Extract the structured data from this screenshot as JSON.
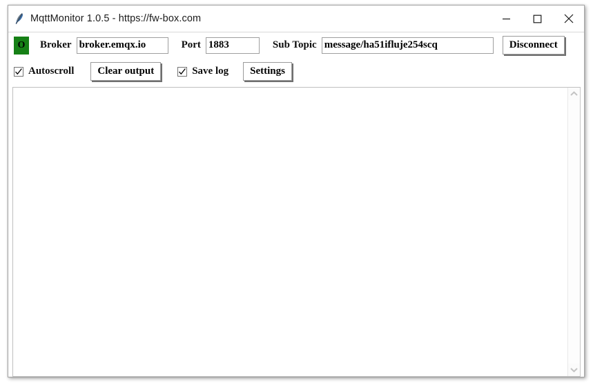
{
  "window": {
    "title": "MqttMonitor 1.0.5 - https://fw-box.com",
    "icon": "feather-icon",
    "controls": {
      "minimize": "minimize-icon",
      "maximize": "maximize-icon",
      "close": "close-icon"
    }
  },
  "toolbar": {
    "status": {
      "text": "O",
      "color": "#168016",
      "text_color": "#000000"
    },
    "broker": {
      "label": "Broker",
      "value": "broker.emqx.io",
      "placeholder": "broker.emqx.io"
    },
    "port": {
      "label": "Port",
      "value": "1883",
      "placeholder": "1883"
    },
    "sub_topic": {
      "label": "Sub Topic",
      "value": "message/ha51ifluje254scq",
      "placeholder": "message/ha51ifluje254scq"
    },
    "connect_button": {
      "label": "Disconnect"
    },
    "autoscroll": {
      "label": "Autoscroll",
      "checked": true
    },
    "clear_output_button": {
      "label": "Clear output"
    },
    "save_log": {
      "label": "Save log",
      "checked": true
    },
    "settings_button": {
      "label": "Settings"
    }
  },
  "output": {
    "content": "",
    "scrollbar": {
      "up_arrow": "chevron-up-icon",
      "down_arrow": "chevron-down-icon"
    }
  }
}
